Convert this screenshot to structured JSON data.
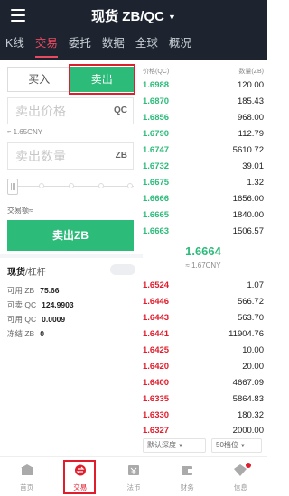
{
  "header": {
    "title": "现货 ZB/QC",
    "tabs": [
      "K线",
      "交易",
      "委托",
      "数据",
      "全球",
      "概况"
    ],
    "active_tab": "交易"
  },
  "trade_panel": {
    "buy_label": "买入",
    "sell_label": "卖出",
    "price_placeholder": "卖出价格",
    "price_unit": "QC",
    "price_cny": "≈ 1.65CNY",
    "amount_placeholder": "卖出数量",
    "amount_unit": "ZB",
    "trade_amount_label": "交易额≈",
    "submit_label": "卖出ZB",
    "spot_label": "现货",
    "margin_label": "/杠杆",
    "balances": [
      {
        "label": "可用 ZB",
        "value": "75.66"
      },
      {
        "label": "可卖 QC",
        "value": "124.9903"
      },
      {
        "label": "可用 QC",
        "value": "0.0009"
      },
      {
        "label": "冻结 ZB",
        "value": "0"
      }
    ]
  },
  "order_book": {
    "price_header": "价格(QC)",
    "qty_header": "数量(ZB)",
    "asks": [
      {
        "price": "1.6988",
        "qty": "120.00"
      },
      {
        "price": "1.6870",
        "qty": "185.43"
      },
      {
        "price": "1.6856",
        "qty": "968.00"
      },
      {
        "price": "1.6790",
        "qty": "112.79"
      },
      {
        "price": "1.6747",
        "qty": "5610.72"
      },
      {
        "price": "1.6732",
        "qty": "39.01"
      },
      {
        "price": "1.6675",
        "qty": "1.32"
      },
      {
        "price": "1.6666",
        "qty": "1656.00"
      },
      {
        "price": "1.6665",
        "qty": "1840.00"
      },
      {
        "price": "1.6663",
        "qty": "1506.57"
      }
    ],
    "last_price": "1.6664",
    "last_cny": "≈ 1.67CNY",
    "bids": [
      {
        "price": "1.6524",
        "qty": "1.07"
      },
      {
        "price": "1.6446",
        "qty": "566.72"
      },
      {
        "price": "1.6443",
        "qty": "563.70"
      },
      {
        "price": "1.6441",
        "qty": "11904.76"
      },
      {
        "price": "1.6425",
        "qty": "10.00"
      },
      {
        "price": "1.6420",
        "qty": "20.00"
      },
      {
        "price": "1.6400",
        "qty": "4667.09"
      },
      {
        "price": "1.6335",
        "qty": "5864.83"
      },
      {
        "price": "1.6330",
        "qty": "180.32"
      },
      {
        "price": "1.6327",
        "qty": "2000.00"
      }
    ],
    "depth_select": "默认深度",
    "levels_select": "50档位"
  },
  "bottom_nav": [
    {
      "label": "首页",
      "icon": "home-icon"
    },
    {
      "label": "交易",
      "icon": "trade-icon"
    },
    {
      "label": "法币",
      "icon": "fiat-icon"
    },
    {
      "label": "财务",
      "icon": "finance-icon"
    },
    {
      "label": "信息",
      "icon": "info-icon"
    }
  ],
  "colors": {
    "header_bg": "#1d2430",
    "sell_green": "#2dbb7a",
    "buy_red": "#e01d2c",
    "accent_tab": "#e84a5f"
  }
}
